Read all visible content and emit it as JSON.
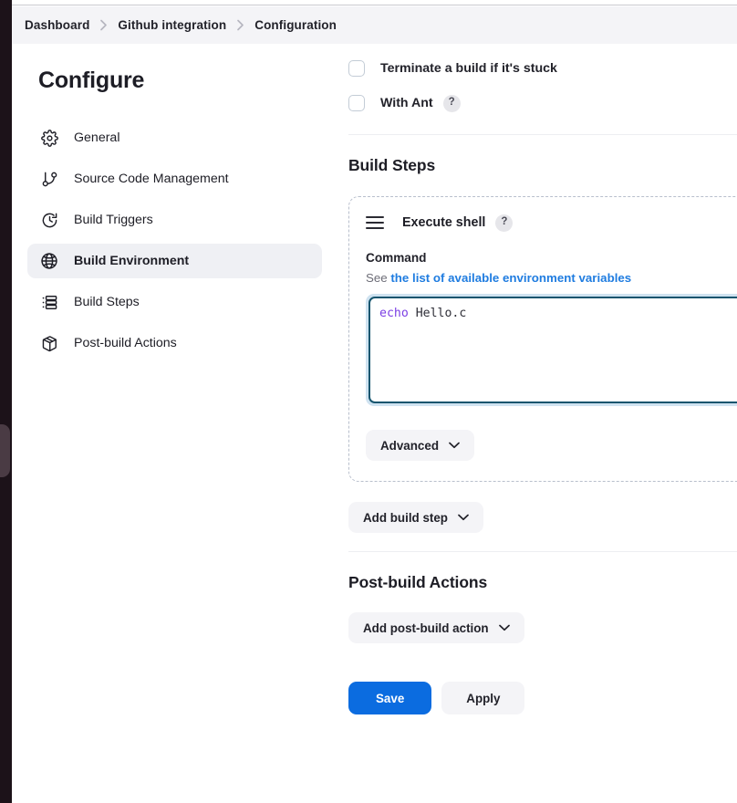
{
  "breadcrumb": {
    "items": [
      {
        "label": "Dashboard"
      },
      {
        "label": "Github integration"
      },
      {
        "label": "Configuration"
      }
    ]
  },
  "sidebar": {
    "title": "Configure",
    "items": [
      {
        "label": "General",
        "icon": "gear-icon",
        "active": false
      },
      {
        "label": "Source Code Management",
        "icon": "git-branch-icon",
        "active": false
      },
      {
        "label": "Build Triggers",
        "icon": "clock-icon",
        "active": false
      },
      {
        "label": "Build Environment",
        "icon": "globe-icon",
        "active": true
      },
      {
        "label": "Build Steps",
        "icon": "list-icon",
        "active": false
      },
      {
        "label": "Post-build Actions",
        "icon": "package-icon",
        "active": false
      }
    ]
  },
  "build_environment": {
    "checkboxes": [
      {
        "label": "Terminate a build if it's stuck",
        "checked": false,
        "help": false
      },
      {
        "label": "With Ant",
        "checked": false,
        "help": true,
        "help_glyph": "?"
      }
    ]
  },
  "build_steps": {
    "heading": "Build Steps",
    "step": {
      "title": "Execute shell",
      "help_glyph": "?",
      "command_label": "Command",
      "help_prefix": "See ",
      "help_link": "the list of available environment variables",
      "command_keyword": "echo",
      "command_rest": " Hello.c",
      "advanced_label": "Advanced"
    },
    "add_step_label": "Add build step"
  },
  "post_build": {
    "heading": "Post-build Actions",
    "add_action_label": "Add post-build action"
  },
  "footer": {
    "save_label": "Save",
    "apply_label": "Apply"
  },
  "colors": {
    "accent_blue": "#0b6ce0",
    "link_blue": "#1f7ce0",
    "keyword_purple": "#7b3fe4",
    "rail_dark": "#1c1219",
    "active_nav_bg": "#eff0f4",
    "editor_focus_border": "#15556e"
  }
}
